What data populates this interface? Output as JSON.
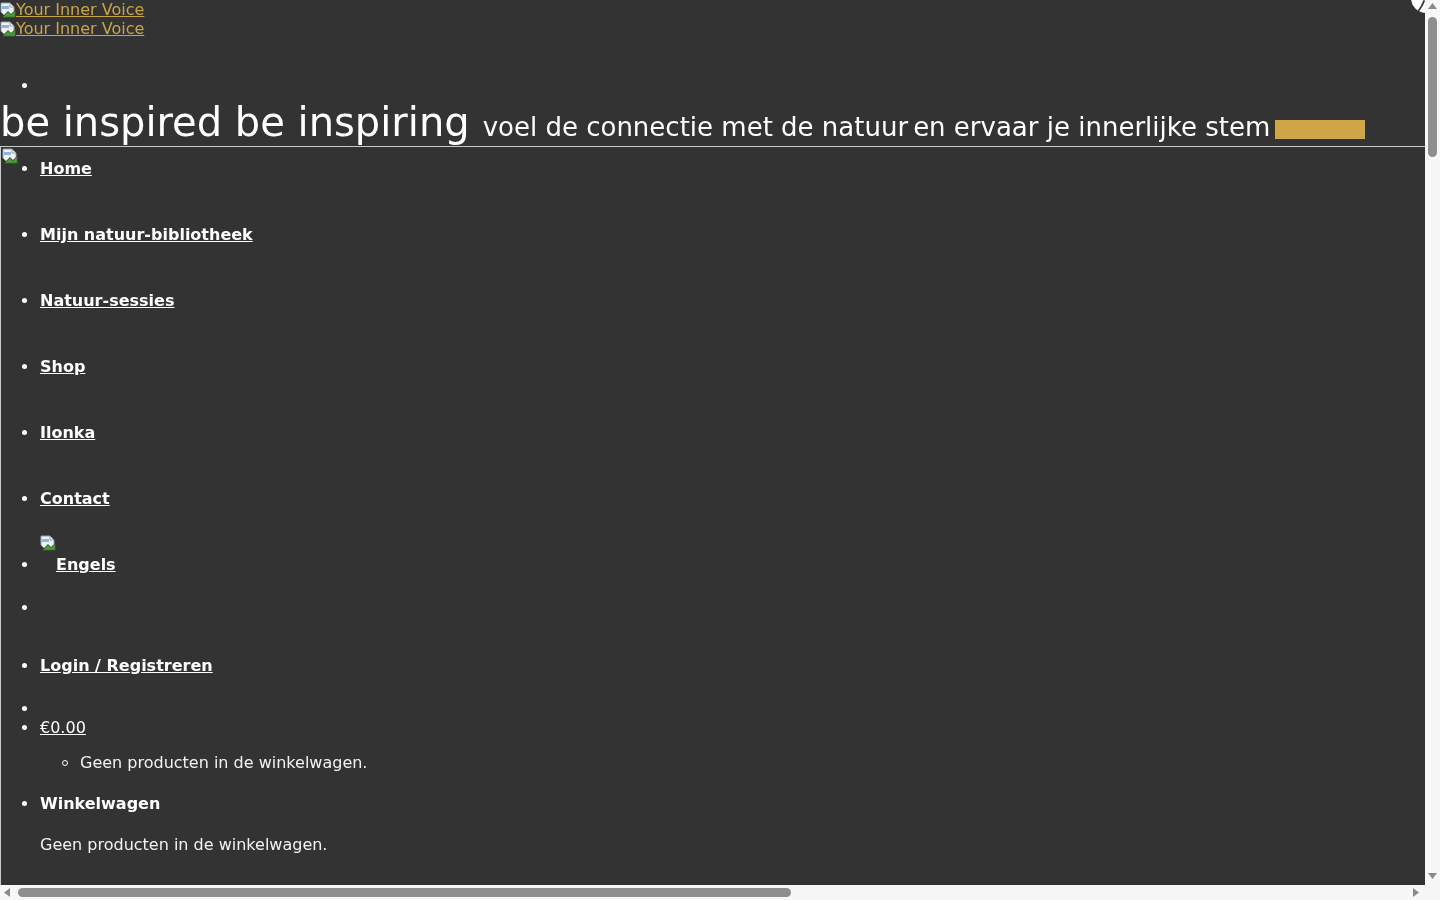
{
  "header": {
    "logo_links": [
      "Your Inner Voice",
      "Your Inner Voice"
    ],
    "top_menu": {
      "items": [
        {
          "kind": "blank"
        }
      ]
    },
    "tagline": {
      "title": "be inspired be inspiring",
      "subtitle_parts": [
        "voel de connectie met de natuur",
        "en ervaar je innerlijke stem"
      ]
    }
  },
  "nav": {
    "items": [
      {
        "kind": "link",
        "label": "Home"
      },
      {
        "kind": "link",
        "label": "Mijn natuur-bibliotheek"
      },
      {
        "kind": "link",
        "label": "Natuur-sessies"
      },
      {
        "kind": "link",
        "label": "Shop"
      },
      {
        "kind": "link",
        "label": "Ilonka"
      },
      {
        "kind": "link",
        "label": "Contact"
      },
      {
        "kind": "language",
        "label": "Engels"
      },
      {
        "kind": "blank"
      },
      {
        "kind": "link",
        "label": "Login / Registreren"
      },
      {
        "kind": "blank"
      },
      {
        "kind": "cart",
        "label": "€0.00",
        "children": [
          {
            "label": "Geen producten in de winkelwagen."
          }
        ]
      },
      {
        "kind": "heading",
        "label": "Winkelwagen"
      }
    ],
    "cart_message": "Geen producten in de winkelwagen."
  }
}
